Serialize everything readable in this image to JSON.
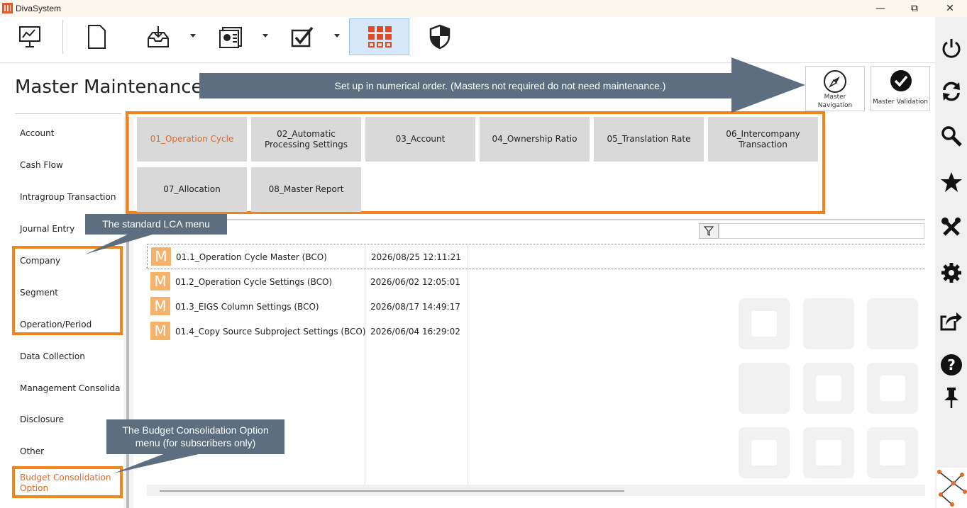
{
  "window": {
    "title": "DivaSystem",
    "minimize": "—",
    "maximize": "⧉",
    "close": "✕"
  },
  "toolbar": {
    "icons": [
      "presentation-icon",
      "document-icon",
      "import-icon",
      "report-icon",
      "checklist-icon",
      "menu-grid-icon",
      "shield-icon"
    ],
    "active": "menu-grid-icon"
  },
  "page": {
    "title": "Master Maintenance"
  },
  "top_buttons": {
    "navigation_label_line1": "Master",
    "navigation_label_line2": "Navigation",
    "validation_label": "Master Validation"
  },
  "sidebar": {
    "items": [
      {
        "label": "Account"
      },
      {
        "label": "Cash Flow"
      },
      {
        "label": "Intragroup Transaction"
      },
      {
        "label": "Journal Entry"
      },
      {
        "label": "Company"
      },
      {
        "label": "Segment"
      },
      {
        "label": "Operation/Period"
      },
      {
        "label": "Data Collection"
      },
      {
        "label": "Management Consolidati"
      },
      {
        "label": "Disclosure"
      },
      {
        "label": "Other"
      },
      {
        "label": "Budget Consolidation Option",
        "line1": "Budget Consolidation",
        "line2": "Option",
        "selected": true
      }
    ]
  },
  "tiles": [
    {
      "label": "01_Operation Cycle",
      "selected": true
    },
    {
      "label": "02_Automatic Processing Settings"
    },
    {
      "label": "03_Account"
    },
    {
      "label": "04_Ownership Ratio"
    },
    {
      "label": "05_Translation Rate"
    },
    {
      "label": "06_Intercompany Transaction"
    },
    {
      "label": "07_Allocation"
    },
    {
      "label": "08_Master Report"
    }
  ],
  "filter": {
    "icon": "filter-icon",
    "value": ""
  },
  "list": {
    "badge": "M",
    "rows": [
      {
        "name": "01.1_Operation Cycle Master (BCO)",
        "date": "2026/08/25 12:11:21"
      },
      {
        "name": "01.2_Operation Cycle Settings (BCO)",
        "date": "2026/06/02 12:05:01"
      },
      {
        "name": "01.3_EIGS Column Settings (BCO)",
        "date": "2026/08/17 14:49:17"
      },
      {
        "name": "01.4_Copy Source Subproject Settings (BCO)",
        "date": "2026/06/04 16:29:02"
      }
    ]
  },
  "rightbar": {
    "icons": [
      "power-icon",
      "refresh-icon",
      "search-icon",
      "star-icon",
      "tools-icon",
      "settings-icon",
      "share-icon",
      "help-icon",
      "pin-icon"
    ]
  },
  "callouts": {
    "numerical_order": "Set up in numerical order. (Masters not required do not need maintenance.)",
    "standard_lca": "The standard LCA menu",
    "budget_line1": "The Budget Consolidation Option",
    "budget_line2": "menu (for subscribers only)"
  },
  "colors": {
    "accent": "#f28419",
    "selected_text": "#e8661f",
    "callout": "#5c6e80",
    "badge": "#f4b26a"
  }
}
